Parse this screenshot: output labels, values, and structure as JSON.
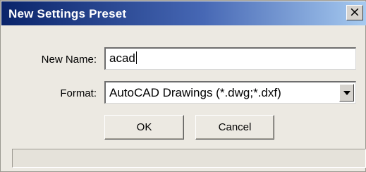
{
  "window": {
    "title": "New Settings Preset",
    "close_glyph": "×"
  },
  "form": {
    "name_label": "New Name:",
    "name_value": "acad",
    "format_label": "Format:",
    "format_value": "AutoCAD Drawings (*.dwg;*.dxf)"
  },
  "buttons": {
    "ok_label": "OK",
    "cancel_label": "Cancel"
  },
  "icons": {
    "close": "close-icon",
    "dropdown": "chevron-down-icon"
  },
  "colors": {
    "titlebar_start": "#0a246a",
    "titlebar_end": "#a6caf0",
    "dialog_bg": "#ece9e2"
  }
}
